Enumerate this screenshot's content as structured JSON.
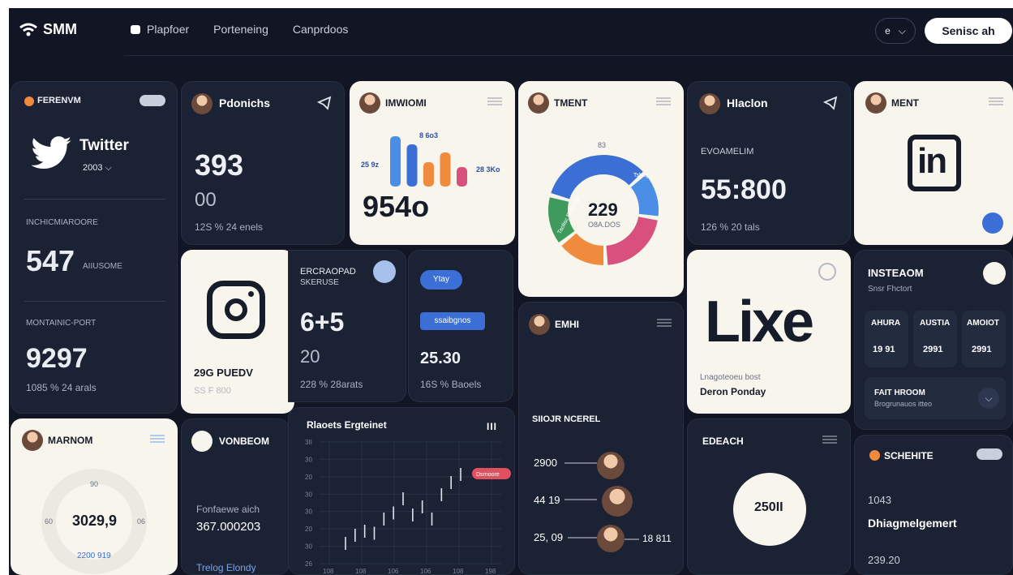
{
  "topbar": {
    "logo_text": "SMM",
    "nav": [
      "Plapfoer",
      "Porteneing",
      "Canprdoos"
    ],
    "toggle_label": "e",
    "search_label": "Senisc ah"
  },
  "card_twitter": {
    "badge": "FERENVM",
    "name": "Twitter",
    "year": "2003 ⌵",
    "metric_label_1": "INCHICMIAROORE",
    "metric_value_1": "547",
    "metric_suffix_1": "AIIUSOME",
    "metric_label_2": "MONTAINIC-PORT",
    "metric_value_2": "9297",
    "metric_foot_2": "1085 % 24 arals"
  },
  "card_pdonichs": {
    "title": "Pdonichs",
    "value": "393",
    "sub_value": "00",
    "foot": "12S % 24 enels"
  },
  "card_imwiomi": {
    "title": "IMWIOMI",
    "label_left": "25 9z",
    "label_top": "8 6o3",
    "label_right": "28 3Ko",
    "value": "954o",
    "bars": [
      {
        "value": 62,
        "color": "#4a8ee6"
      },
      {
        "value": 52,
        "color": "#3b6fd6"
      },
      {
        "value": 30,
        "color": "#f08a3c"
      },
      {
        "value": 42,
        "color": "#f08a3c"
      },
      {
        "value": 24,
        "color": "#d8507d"
      }
    ]
  },
  "card_tment": {
    "title": "TMENT",
    "center_value": "229",
    "center_label": "O8A.DOS",
    "top_label": "83",
    "ring_label_left": "Taolisc Enpoogd",
    "ring_label_right": "Tsbog",
    "segments": [
      {
        "value": 34,
        "color": "#3b6fd6"
      },
      {
        "value": 14,
        "color": "#4a8ee6"
      },
      {
        "value": 22,
        "color": "#d8507d"
      },
      {
        "value": 15,
        "color": "#f08a3c"
      },
      {
        "value": 15,
        "color": "#3f9a5e"
      }
    ]
  },
  "card_hlaclon": {
    "title": "Hlaclon",
    "label": "EVOAMELIM",
    "value": "55:800",
    "foot": "126 % 20 tals"
  },
  "card_linkedin": {
    "title": "MENT",
    "logo": "in"
  },
  "card_instagram_combo": {
    "name": "29G PUEDV",
    "sub": "SS F 800",
    "label_1": "ERCRAOPAD",
    "label_2": "SKERUSE",
    "value": "6+5",
    "sub_value": "20",
    "foot": "228 % 28arats",
    "pill_1": "Ytay",
    "pill_2": "ssaibgnos",
    "value_2": "25.30",
    "foot_2": "16S % Baoels"
  },
  "card_lixe": {
    "logo": "Lixe",
    "sub_label": "Lnagoteoeu bost",
    "name": "Deron Ponday"
  },
  "card_instaeom": {
    "title": "INSTEAOM",
    "subtitle": "Snsr Fhctort",
    "stats": [
      {
        "label": "AHURA",
        "value": "19 91"
      },
      {
        "label": "AUSTIA",
        "value": "2991"
      },
      {
        "label": "AMOIOT",
        "value": "2991"
      }
    ],
    "row_title": "FAIT HROOM",
    "row_sub": "Brogrunauos itteo"
  },
  "card_emhi": {
    "title": "EMHI",
    "section": "SIIOJR NCEREL",
    "values": [
      "2900",
      "44 19",
      "25, 09"
    ],
    "right_value": "18 811"
  },
  "card_marnom": {
    "title": "MARNOM",
    "center_value": "3029,9",
    "top": "90",
    "left": "60",
    "right": "06",
    "bottom": "2200 919"
  },
  "card_vonbeom": {
    "title": "VONBEOM",
    "label": "Fonfaewe aich",
    "value": "367.000203",
    "foot": "Trelog Elondy"
  },
  "card_chart": {
    "title": "Rlaoets Ergteinet",
    "tag": "Dsrnoore"
  },
  "card_edeach": {
    "title": "EDEACH",
    "value": "250II"
  },
  "card_schehite": {
    "title": "SCHEHITE",
    "value": "1043",
    "name": "Dhiagmelgemert",
    "foot": "239.20"
  },
  "chart_data": {
    "type": "line",
    "title": "Rlaoets Ergteinet",
    "y_ticks": [
      "3II",
      "30",
      "20",
      "30",
      "30",
      "20",
      "30",
      "26"
    ],
    "x_ticks": [
      "108",
      "108",
      "106",
      "106",
      "108",
      "198"
    ],
    "series": [
      {
        "values": [
          10,
          14,
          16,
          15,
          22,
          25,
          32,
          24,
          28,
          22,
          34,
          40,
          44
        ]
      }
    ],
    "ylim": [
      0,
      60
    ]
  }
}
